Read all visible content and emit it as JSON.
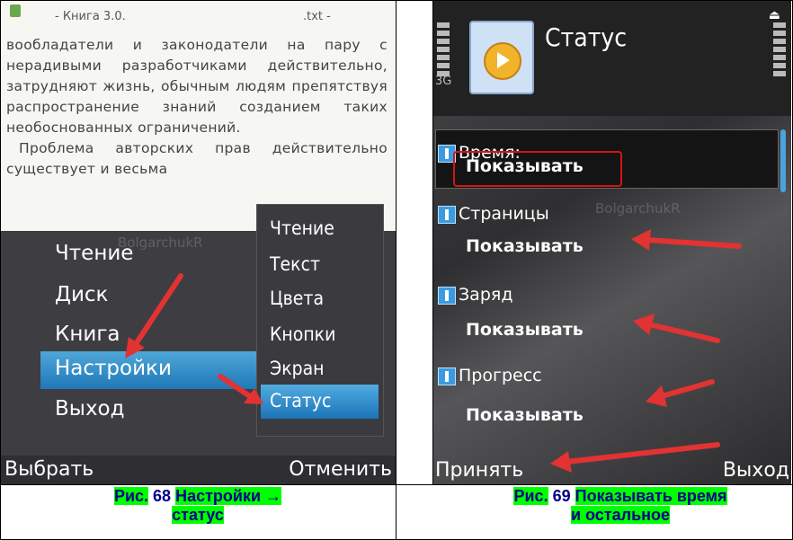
{
  "left": {
    "header": {
      "center": "- Книга 3.0.",
      "right": ".txt -"
    },
    "paragraphs": [
      "вообладатели и законодатели на пару с нерадивыми разработчиками действительно, затрудняют жизнь, обычным людям препятствуя распространение знаний созданием таких необоснованных ограничений.",
      "Проблема авторских прав действительно существует и весьма"
    ],
    "menu": {
      "items": [
        "Чтение",
        "Диск",
        "Книга",
        "Настройки",
        "Выход"
      ],
      "selected": "Настройки"
    },
    "submenu": {
      "items": [
        "Чтение",
        "Текст",
        "Цвета",
        "Кнопки",
        "Экран",
        "Статус"
      ],
      "selected": "Статус"
    },
    "watermark": "BolgarchukR",
    "softkeys": {
      "left": "Выбрать",
      "right": "Отменить"
    },
    "caption": {
      "prefix": "Рис.",
      "number": "68",
      "text1": "Настройки →",
      "text2": "статус"
    }
  },
  "right": {
    "status": {
      "network": "3G"
    },
    "title": "Статус",
    "watermark": "BolgarchukR",
    "fields": [
      {
        "label": "Время:",
        "value": "Показывать"
      },
      {
        "label": "Страницы",
        "value": "Показывать"
      },
      {
        "label": "Заряд",
        "value": "Показывать"
      },
      {
        "label": "Прогресс",
        "value": "Показывать"
      }
    ],
    "softkeys": {
      "left": "Принять",
      "right": "Выход"
    },
    "caption": {
      "prefix": "Рис.",
      "number": "69",
      "text1": "Показывать время",
      "text2": "и остальное"
    }
  },
  "colors": {
    "arrow": "#e23232",
    "selection": "#2a8ccb",
    "caption_highlight": "#00ff00",
    "caption_text": "#00008b"
  }
}
